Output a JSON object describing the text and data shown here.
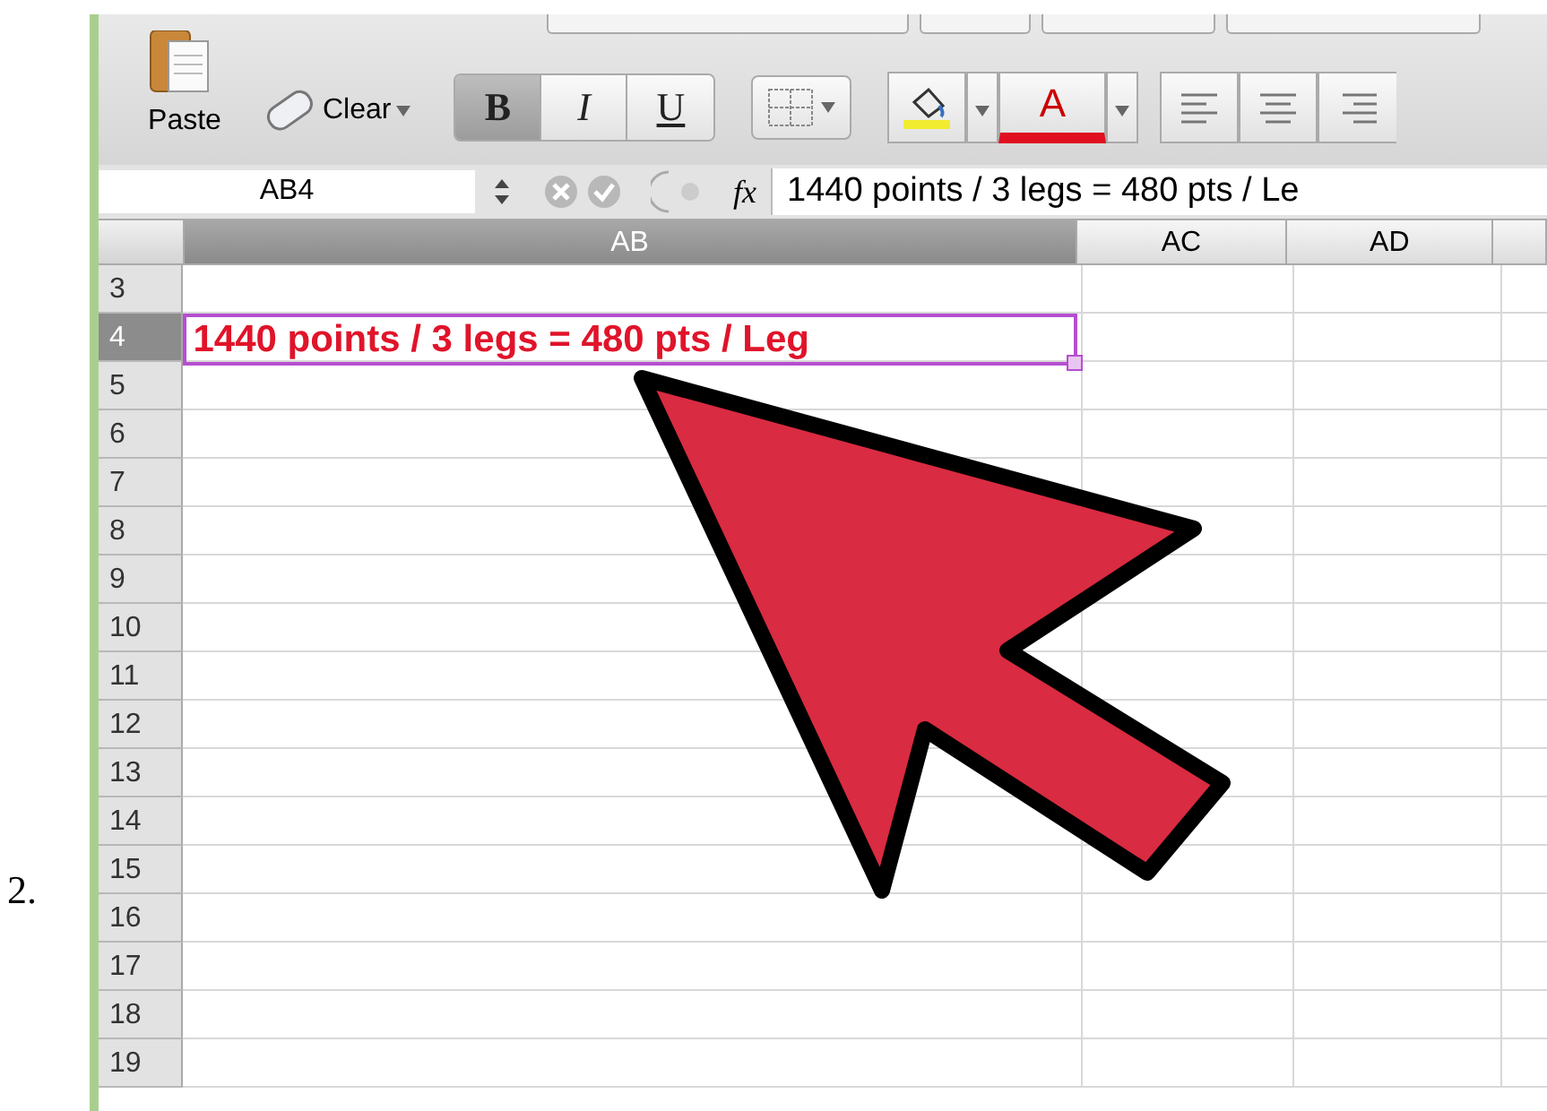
{
  "step_number": "2.",
  "toolbar": {
    "paste_label": "Paste",
    "clear_label": "Clear",
    "font_color_label": "A",
    "format_buttons": [
      {
        "label": "B",
        "selected": true
      },
      {
        "label": "I",
        "selected": false
      },
      {
        "label": "U",
        "selected": false
      }
    ]
  },
  "formula_bar": {
    "cell_reference": "AB4",
    "fx_label": "fx",
    "formula": "1440 points / 3 legs = 480 pts / Le"
  },
  "sheet": {
    "columns": [
      {
        "label": "AB",
        "selected": true
      },
      {
        "label": "AC",
        "selected": false
      },
      {
        "label": "AD",
        "selected": false
      }
    ],
    "rows": [
      {
        "label": "3",
        "selected": false
      },
      {
        "label": "4",
        "selected": true,
        "value": "1440 points / 3 legs = 480 pts / Leg"
      },
      {
        "label": "5",
        "selected": false
      },
      {
        "label": "6",
        "selected": false
      },
      {
        "label": "7",
        "selected": false
      },
      {
        "label": "8",
        "selected": false
      },
      {
        "label": "9",
        "selected": false
      },
      {
        "label": "10",
        "selected": false
      },
      {
        "label": "11",
        "selected": false
      },
      {
        "label": "12",
        "selected": false
      },
      {
        "label": "13",
        "selected": false
      },
      {
        "label": "14",
        "selected": false
      },
      {
        "label": "15",
        "selected": false
      },
      {
        "label": "16",
        "selected": false
      },
      {
        "label": "17",
        "selected": false
      },
      {
        "label": "18",
        "selected": false
      },
      {
        "label": "19",
        "selected": false
      }
    ]
  }
}
